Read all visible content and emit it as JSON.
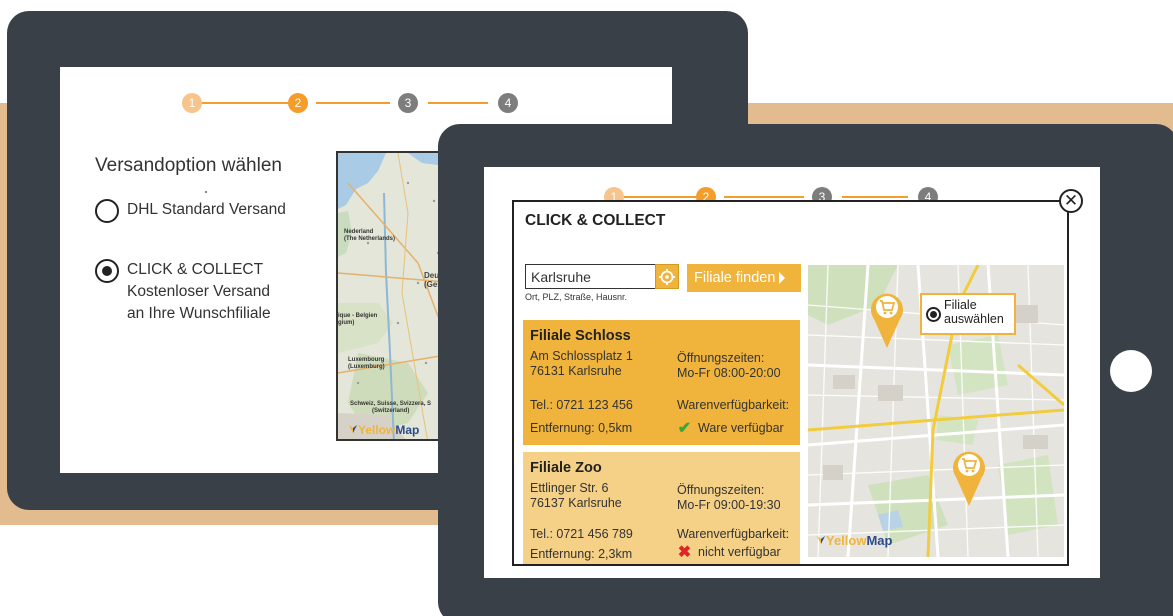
{
  "colors": {
    "accent": "#f0b43c",
    "step_done": "#f7c58c",
    "step_active": "#f59d2a",
    "step_todo": "#7d7d7d",
    "device": "#3a4048",
    "backdrop": "#e2bb8e"
  },
  "back_screen": {
    "steps": [
      "1",
      "2",
      "3",
      "4"
    ],
    "title": "Versandoption wählen",
    "options": [
      {
        "label": "DHL Standard Versand",
        "selected": false
      },
      {
        "label": "CLICK & COLLECT",
        "sublabel_1": "Kostenloser Versand",
        "sublabel_2": "an Ihre Wunschfiliale",
        "selected": true
      }
    ],
    "map_labels": {
      "netherlands": "Nederland",
      "netherlands_en": "(The Netherlands)",
      "belgium": "ique - Belgien",
      "belgium_2": "gium)",
      "luxembourg": "Luxembourg",
      "luxembourg_2": "(Luxemburg)",
      "germany": "Deut",
      "germany_2": "(Ger",
      "switzerland": "Schweiz, Suisse, Svizzera, S",
      "switzerland_2": "(Switzerland)"
    },
    "logo_yellow": "Yellow",
    "logo_blue": "Map"
  },
  "front_screen": {
    "steps": [
      "1",
      "2",
      "3",
      "4"
    ],
    "close_icon": "✕",
    "title": "CLICK & COLLECT",
    "search": {
      "value": "Karlsruhe",
      "hint": "Ort, PLZ, Straße, Hausnr."
    },
    "find_button": "Filiale finden",
    "stores": [
      {
        "name": "Filiale Schloss",
        "street": "Am Schlossplatz 1",
        "city": "76131 Karlsruhe",
        "phone": "Tel.: 0721 123 456",
        "distance": "Entfernung: 0,5km",
        "hours_label": "Öffnungszeiten:",
        "hours": "Mo-Fr 08:00-20:00",
        "availability_label": "Warenverfügbarkeit:",
        "availability": "Ware verfügbar",
        "available": true
      },
      {
        "name": "Filiale Zoo",
        "street": "Ettlinger Str. 6",
        "city": "76137 Karlsruhe",
        "phone": "Tel.: 0721 456 789",
        "distance": "Entfernung: 2,3km",
        "hours_label": "Öffnungszeiten:",
        "hours": "Mo-Fr 09:00-19:30",
        "availability_label": "Warenverfügbarkeit:",
        "availability": "nicht verfügbar",
        "available": false
      }
    ],
    "map_popup": {
      "line1": "Filiale",
      "line2": "auswählen"
    },
    "logo_yellow": "Yellow",
    "logo_blue": "Map",
    "check_icon": "✔",
    "cross_icon": "✖"
  }
}
